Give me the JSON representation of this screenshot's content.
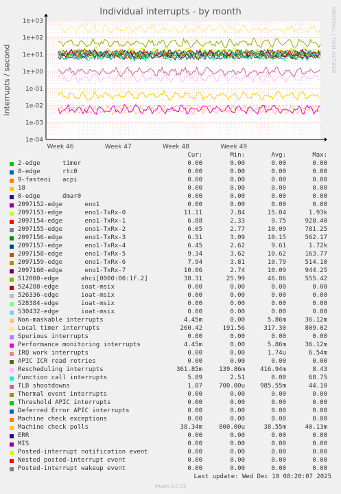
{
  "title": "Individual interrupts - by month",
  "watermark": "RRDTOOL / TOBI OETIKER",
  "version": "Munin 2.0.73",
  "last_update": "Last update: Wed Dec 10 08:20:07 2025",
  "table_headers": {
    "cur": "Cur:",
    "min": "Min:",
    "avg": "Avg:",
    "max": "Max:"
  },
  "chart_data": {
    "type": "line",
    "title": "Individual interrupts - by month",
    "ylabel": "interrupts / second",
    "yscale": "log",
    "ylim": [
      0.0001,
      1000
    ],
    "y_ticks": [
      "1e-04",
      "1e-03",
      "1e-02",
      "1e-01",
      "1e+00",
      "1e+01",
      "1e+02",
      "1e+03"
    ],
    "x_ticks": [
      "Week 46",
      "Week 47",
      "Week 48",
      "Week 49"
    ],
    "grid": true,
    "series": [
      {
        "name": "2-edge      timer",
        "color": "#00cc00",
        "cur": "0.00",
        "min": "0.00",
        "avg": "0.00",
        "max": "0.00"
      },
      {
        "name": "8-edge      rtc0",
        "color": "#0066b3",
        "cur": "0.00",
        "min": "0.00",
        "avg": "0.00",
        "max": "0.00"
      },
      {
        "name": "9-fasteoi   acpi",
        "color": "#ff8000",
        "cur": "0.00",
        "min": "0.00",
        "avg": "0.00",
        "max": "0.00"
      },
      {
        "name": "18",
        "color": "#ffcc00",
        "cur": "0.00",
        "min": "0.00",
        "avg": "0.00",
        "max": "0.00"
      },
      {
        "name": "0-edge      dmar0",
        "color": "#330099",
        "cur": "0.00",
        "min": "0.00",
        "avg": "0.00",
        "max": "0.00"
      },
      {
        "name": "2097152-edge      eno1",
        "color": "#990099",
        "cur": "0.00",
        "min": "0.00",
        "avg": "0.00",
        "max": "0.00"
      },
      {
        "name": "2097153-edge      eno1-TxRx-0",
        "color": "#ccff00",
        "cur": "11.11",
        "min": "7.84",
        "avg": "15.04",
        "max": "1.93k"
      },
      {
        "name": "2097154-edge      eno1-TxRx-1",
        "color": "#ff0000",
        "cur": "6.88",
        "min": "2.33",
        "avg": "9.75",
        "max": "928.40"
      },
      {
        "name": "2097155-edge      eno1-TxRx-2",
        "color": "#808080",
        "cur": "6.05",
        "min": "2.77",
        "avg": "10.09",
        "max": "781.25"
      },
      {
        "name": "2097156-edge      eno1-TxRx-3",
        "color": "#008f00",
        "cur": "6.51",
        "min": "3.09",
        "avg": "10.15",
        "max": "562.17"
      },
      {
        "name": "2097157-edge      eno1-TxRx-4",
        "color": "#00487d",
        "cur": "6.45",
        "min": "2.62",
        "avg": "9.61",
        "max": "1.72k"
      },
      {
        "name": "2097158-edge      eno1-TxRx-5",
        "color": "#b35a00",
        "cur": "9.34",
        "min": "3.62",
        "avg": "10.62",
        "max": "163.77"
      },
      {
        "name": "2097159-edge      eno1-TxRx-6",
        "color": "#b38f00",
        "cur": "7.94",
        "min": "3.81",
        "avg": "10.79",
        "max": "514.10"
      },
      {
        "name": "2097160-edge      eno1-TxRx-7",
        "color": "#6b006b",
        "cur": "10.06",
        "min": "2.74",
        "avg": "10.09",
        "max": "944.25"
      },
      {
        "name": "512000-edge      ahci[0000:00:1f.2]",
        "color": "#8fb300",
        "cur": "38.31",
        "min": "25.99",
        "avg": "46.86",
        "max": "555.42"
      },
      {
        "name": "524288-edge      ioat-msix",
        "color": "#b30000",
        "cur": "0.00",
        "min": "0.00",
        "avg": "0.00",
        "max": "0.00"
      },
      {
        "name": "526336-edge      ioat-msix",
        "color": "#bebebe",
        "cur": "0.00",
        "min": "0.00",
        "avg": "0.00",
        "max": "0.00"
      },
      {
        "name": "528384-edge      ioat-msix",
        "color": "#80ff80",
        "cur": "0.00",
        "min": "0.00",
        "avg": "0.00",
        "max": "0.00"
      },
      {
        "name": "530432-edge      ioat-msix",
        "color": "#80c9ff",
        "cur": "0.00",
        "min": "0.00",
        "avg": "0.00",
        "max": "0.00"
      },
      {
        "name": "Non-maskable interrupts",
        "color": "#ffc080",
        "cur": "4.45m",
        "min": "0.00",
        "avg": "5.86m",
        "max": "36.12m"
      },
      {
        "name": "Local timer interrupts",
        "color": "#ffe680",
        "cur": "260.42",
        "min": "191.56",
        "avg": "317.30",
        "max": "809.02"
      },
      {
        "name": "Spurious interrupts",
        "color": "#aa80ff",
        "cur": "0.00",
        "min": "0.00",
        "avg": "0.00",
        "max": "0.00"
      },
      {
        "name": "Performance monitoring interrupts",
        "color": "#ee00cc",
        "cur": "4.45m",
        "min": "0.00",
        "avg": "5.86m",
        "max": "36.12m"
      },
      {
        "name": "IRQ work interrupts",
        "color": "#ff8080",
        "cur": "0.00",
        "min": "0.00",
        "avg": "1.74u",
        "max": "6.54m"
      },
      {
        "name": "APIC ICR read retries",
        "color": "#666600",
        "cur": "0.00",
        "min": "0.00",
        "avg": "0.00",
        "max": "0.00"
      },
      {
        "name": "Rescheduling interrupts",
        "color": "#ffbfff",
        "cur": "361.85m",
        "min": "139.86m",
        "avg": "416.94m",
        "max": "8.43"
      },
      {
        "name": "Function call interrupts",
        "color": "#00ffcc",
        "cur": "5.89",
        "min": "2.51",
        "avg": "8.00",
        "max": "68.75"
      },
      {
        "name": "TLB shootdowns",
        "color": "#cc6699",
        "cur": "1.07",
        "min": "700.00u",
        "avg": "985.55m",
        "max": "44.10"
      },
      {
        "name": "Thermal event interrupts",
        "color": "#999900",
        "cur": "0.00",
        "min": "0.00",
        "avg": "0.00",
        "max": "0.00"
      },
      {
        "name": "Threshold APIC interrupts",
        "color": "#00cc00",
        "cur": "0.00",
        "min": "0.00",
        "avg": "0.00",
        "max": "0.00"
      },
      {
        "name": "Deferred Error APIC interrupts",
        "color": "#0066b3",
        "cur": "0.00",
        "min": "0.00",
        "avg": "0.00",
        "max": "0.00"
      },
      {
        "name": "Machine check exceptions",
        "color": "#ff8000",
        "cur": "0.00",
        "min": "0.00",
        "avg": "0.00",
        "max": "0.00"
      },
      {
        "name": "Machine check polls",
        "color": "#ffcc00",
        "cur": "38.34m",
        "min": "800.00u",
        "avg": "38.55m",
        "max": "40.13m"
      },
      {
        "name": "ERR",
        "color": "#330099",
        "cur": "0.00",
        "min": "0.00",
        "avg": "0.00",
        "max": "0.00"
      },
      {
        "name": "MIS",
        "color": "#990099",
        "cur": "0.00",
        "min": "0.00",
        "avg": "0.00",
        "max": "0.00"
      },
      {
        "name": "Posted-interrupt notification event",
        "color": "#ccff00",
        "cur": "0.00",
        "min": "0.00",
        "avg": "0.00",
        "max": "0.00"
      },
      {
        "name": "Nested posted-interrupt event",
        "color": "#ff0000",
        "cur": "0.00",
        "min": "0.00",
        "avg": "0.00",
        "max": "0.00"
      },
      {
        "name": "Posted-interrupt wakeup event",
        "color": "#808080",
        "cur": "0.00",
        "min": "0.00",
        "avg": "0.00",
        "max": "0.00"
      }
    ]
  }
}
